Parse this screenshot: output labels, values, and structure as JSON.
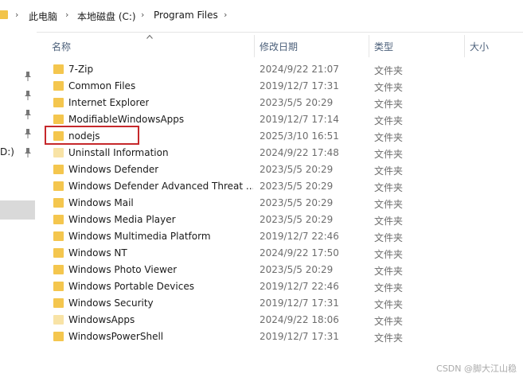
{
  "breadcrumb": {
    "items": [
      "此电脑",
      "本地磁盘 (C:)",
      "Program Files"
    ],
    "separator": "›"
  },
  "nav": {
    "partial_label": "D:)"
  },
  "headers": {
    "name": "名称",
    "date": "修改日期",
    "type": "类型",
    "size": "大小"
  },
  "files": [
    {
      "name": "7-Zip",
      "date": "2024/9/22 21:07",
      "type": "文件夹",
      "icon": "folder-icon"
    },
    {
      "name": "Common Files",
      "date": "2019/12/7 17:31",
      "type": "文件夹",
      "icon": "folder-icon"
    },
    {
      "name": "Internet Explorer",
      "date": "2023/5/5 20:29",
      "type": "文件夹",
      "icon": "folder-icon"
    },
    {
      "name": "ModifiableWindowsApps",
      "date": "2019/12/7 17:14",
      "type": "文件夹",
      "icon": "folder-icon"
    },
    {
      "name": "nodejs",
      "date": "2025/3/10 16:51",
      "type": "文件夹",
      "icon": "folder-icon"
    },
    {
      "name": "Uninstall Information",
      "date": "2024/9/22 17:48",
      "type": "文件夹",
      "icon": "folder-faded-icon"
    },
    {
      "name": "Windows Defender",
      "date": "2023/5/5 20:29",
      "type": "文件夹",
      "icon": "folder-icon"
    },
    {
      "name": "Windows Defender Advanced Threat ...",
      "date": "2023/5/5 20:29",
      "type": "文件夹",
      "icon": "folder-icon"
    },
    {
      "name": "Windows Mail",
      "date": "2023/5/5 20:29",
      "type": "文件夹",
      "icon": "folder-icon"
    },
    {
      "name": "Windows Media Player",
      "date": "2023/5/5 20:29",
      "type": "文件夹",
      "icon": "folder-icon"
    },
    {
      "name": "Windows Multimedia Platform",
      "date": "2019/12/7 22:46",
      "type": "文件夹",
      "icon": "folder-icon"
    },
    {
      "name": "Windows NT",
      "date": "2024/9/22 17:50",
      "type": "文件夹",
      "icon": "folder-icon"
    },
    {
      "name": "Windows Photo Viewer",
      "date": "2023/5/5 20:29",
      "type": "文件夹",
      "icon": "folder-icon"
    },
    {
      "name": "Windows Portable Devices",
      "date": "2019/12/7 22:46",
      "type": "文件夹",
      "icon": "folder-icon"
    },
    {
      "name": "Windows Security",
      "date": "2019/12/7 17:31",
      "type": "文件夹",
      "icon": "folder-icon"
    },
    {
      "name": "WindowsApps",
      "date": "2024/9/22 18:06",
      "type": "文件夹",
      "icon": "folder-faded-icon"
    },
    {
      "name": "WindowsPowerShell",
      "date": "2019/12/7 17:31",
      "type": "文件夹",
      "icon": "folder-icon"
    }
  ],
  "highlight_color": "#c6282b",
  "watermark": "CSDN @脚大江山稳"
}
